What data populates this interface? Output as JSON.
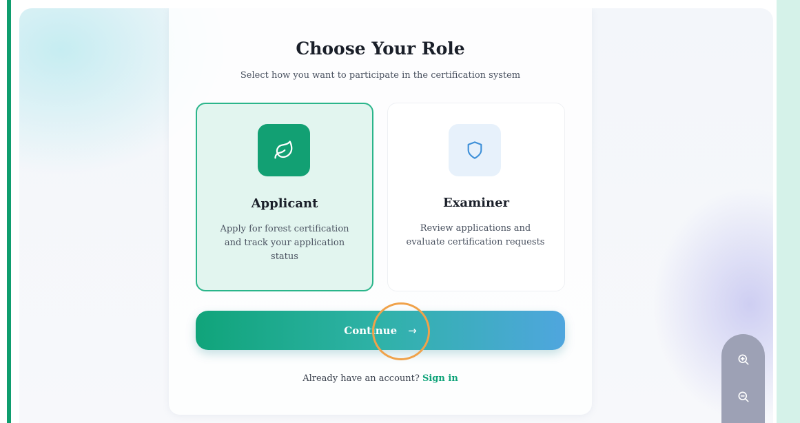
{
  "header": {
    "title": "Choose Your Role",
    "subtitle": "Select how you want to participate in the certification system"
  },
  "roles": [
    {
      "name": "Applicant",
      "description": "Apply for forest certification and track your application status",
      "icon": "leaf-icon",
      "selected": true
    },
    {
      "name": "Examiner",
      "description": "Review applications and evaluate certification requests",
      "icon": "shield-icon",
      "selected": false
    }
  ],
  "actions": {
    "continue_label": "Continue",
    "continue_icon": "arrow-right-icon"
  },
  "footer": {
    "prompt": "Already have an account?",
    "signin_label": "Sign in"
  },
  "zoom": {
    "in_icon": "zoom-in-icon",
    "out_icon": "zoom-out-icon"
  },
  "colors": {
    "accent_green": "#10a47a",
    "accent_blue": "#4fa6de",
    "selected_bg": "#e2f5ef",
    "click_indicator": "#f0a24a"
  }
}
